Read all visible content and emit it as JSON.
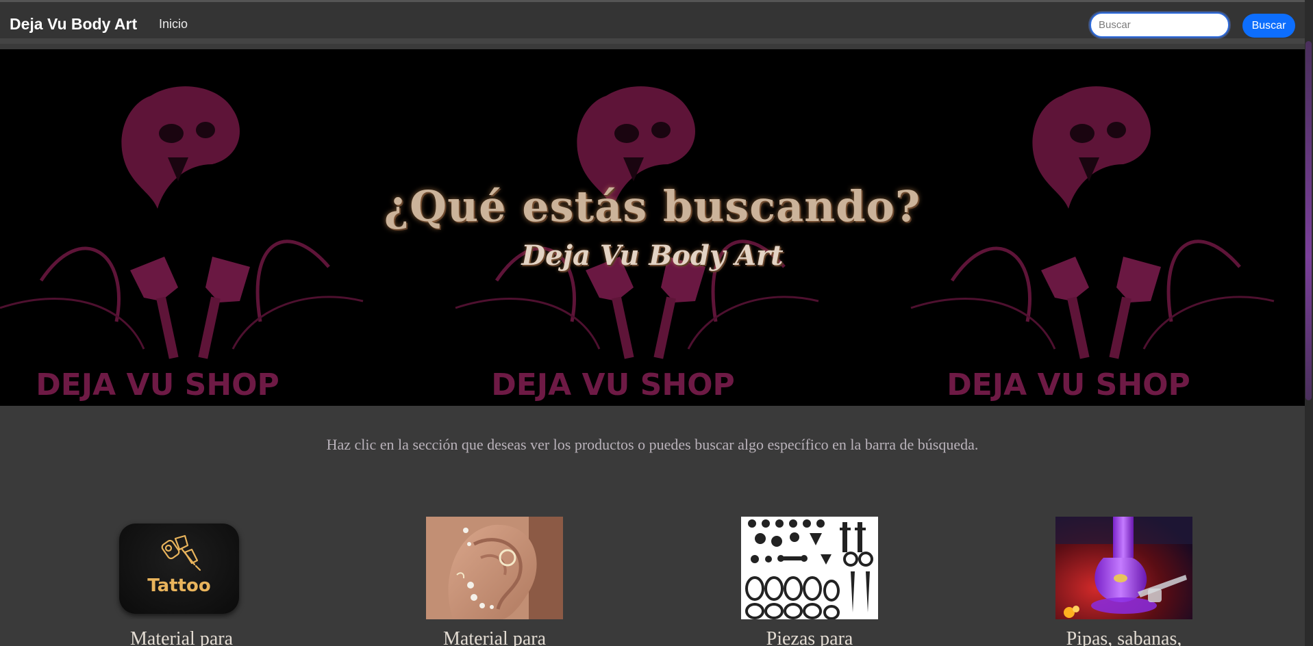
{
  "navbar": {
    "brand": "Deja Vu Body Art",
    "links": [
      {
        "label": "Inicio"
      }
    ],
    "search": {
      "placeholder": "Buscar",
      "value": "",
      "button_label": "Buscar"
    }
  },
  "hero": {
    "title": "¿Qué estás buscando?",
    "subtitle": "Deja Vu Body Art",
    "background_logo_text": "DEJA VU SHOP"
  },
  "intro": "Haz clic en la sección que deseas ver los productos o puedes buscar algo específico en la barra de búsqueda.",
  "categories": [
    {
      "label": "Material para",
      "image_text": "Tattoo",
      "icon": "tattoo-machine-icon"
    },
    {
      "label": "Material para",
      "icon": "ear-piercing-photo"
    },
    {
      "label": "Piezas para",
      "icon": "piercing-jewelry-photo"
    },
    {
      "label": "Pipas, sabanas,",
      "icon": "glass-pipe-photo"
    }
  ],
  "colors": {
    "accent": "#0d6efd",
    "navbar": "#343434",
    "background": "#3a3a3a",
    "hero_motif": "#6e1a45",
    "tattoo_gold": "#e9b45c"
  }
}
